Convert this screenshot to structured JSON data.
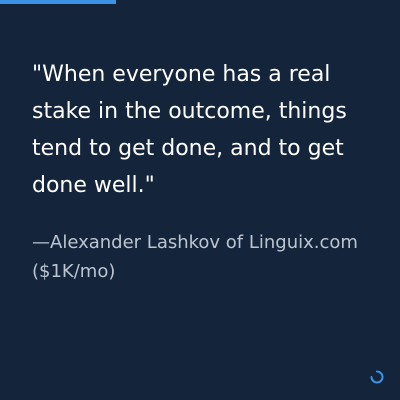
{
  "quote": {
    "text": "\"When everyone has a real stake in the outcome, things tend to get done, and to get done well.\"",
    "attribution": "—Alexander Lashkov of Linguix.com ($1K/mo)"
  },
  "icons": {
    "loader": "loading-spinner-icon"
  },
  "colors": {
    "background": "#13243b",
    "accent": "#3a93e4",
    "quote_text": "#ffffff",
    "attribution_text": "#bdc5d0"
  }
}
